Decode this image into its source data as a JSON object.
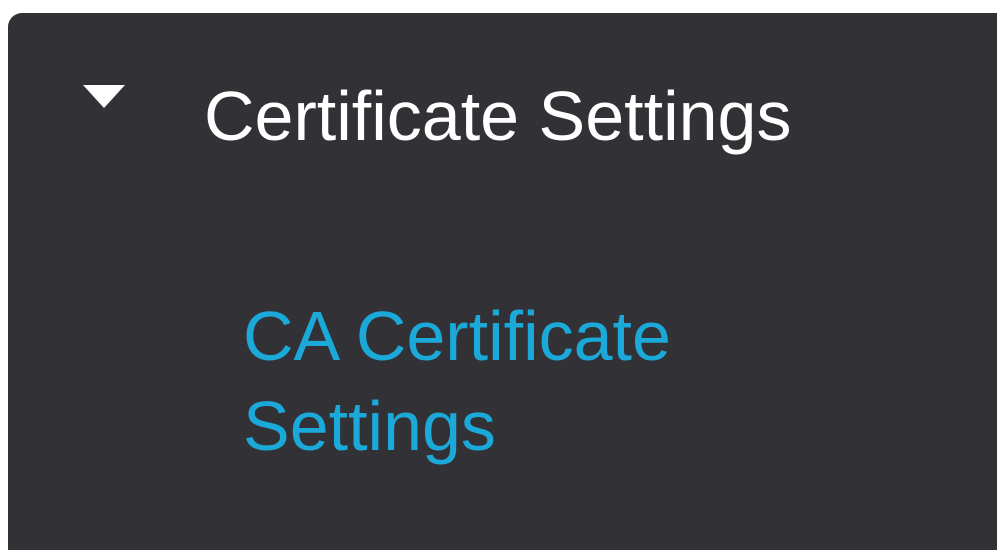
{
  "section": {
    "title": "Certificate Settings",
    "caret_icon": "caret-down-icon",
    "expanded": true
  },
  "items": [
    {
      "label": "CA Certificate Settings"
    }
  ],
  "colors": {
    "panel_bg": "#323236",
    "title_text": "#ffffff",
    "link_text": "#1ba9d9"
  }
}
